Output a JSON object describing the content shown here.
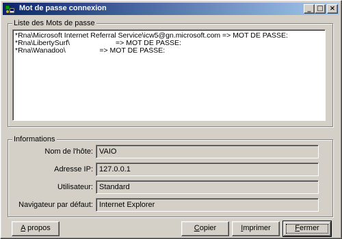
{
  "window": {
    "title": "Mot de passe connexion",
    "controls": {
      "minimize": "_",
      "maximize": "□",
      "close": "×"
    }
  },
  "passwords_group": {
    "legend": "Liste des Mots de passe",
    "lines": [
      "*Rna\\Microsoft Internet Referral Service\\icw5@gn.microsoft.com => MOT DE PASSE:",
      "*Rna\\LibertySurf\\                       => MOT DE PASSE:",
      "*Rna\\Wanadoo\\                 => MOT DE PASSE:"
    ]
  },
  "info_group": {
    "legend": "Informations",
    "fields": [
      {
        "label": "Nom de l'hôte:",
        "value": "VAIO"
      },
      {
        "label": "Adresse IP:",
        "value": "127.0.0.1"
      },
      {
        "label": "Utilisateur:",
        "value": "Standard"
      },
      {
        "label": "Navigateur par défaut:",
        "value": "Internet Explorer"
      }
    ]
  },
  "buttons": {
    "about": {
      "hotkey": "A",
      "rest": " propos"
    },
    "copy": {
      "hotkey": "C",
      "rest": "opier"
    },
    "print": {
      "hotkey": "I",
      "rest": "mprimer"
    },
    "close": {
      "hotkey": "F",
      "rest": "ermer"
    }
  }
}
